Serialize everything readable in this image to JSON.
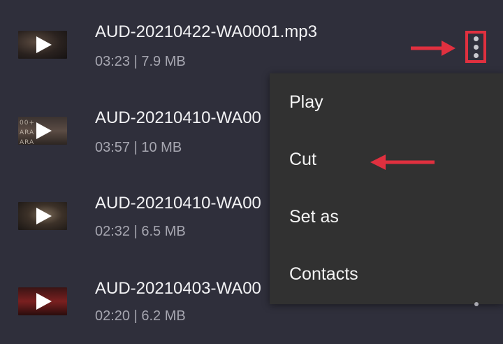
{
  "files": [
    {
      "title": "AUD-20210422-WA0001.mp3",
      "meta": "03:23 | 7.9 MB"
    },
    {
      "title": "AUD-20210410-WA00",
      "meta": "03:57 | 10 MB",
      "thumb_text": "00+ ARA ARA"
    },
    {
      "title": "AUD-20210410-WA00",
      "meta": "02:32 | 6.5 MB"
    },
    {
      "title": "AUD-20210403-WA00",
      "meta": "02:20 | 6.2 MB"
    }
  ],
  "menu": {
    "items": [
      {
        "label": "Play"
      },
      {
        "label": "Cut"
      },
      {
        "label": "Set as"
      },
      {
        "label": "Contacts"
      }
    ]
  },
  "colors": {
    "background": "#2f2f3b",
    "menu_bg": "#313131",
    "annotation_red": "#e0303f",
    "title_text": "#f2f2f4",
    "meta_text": "#a6a6b0"
  },
  "icons": {
    "play": "play-icon",
    "more": "more-vert-icon",
    "annotation": "red-arrow-icon"
  }
}
